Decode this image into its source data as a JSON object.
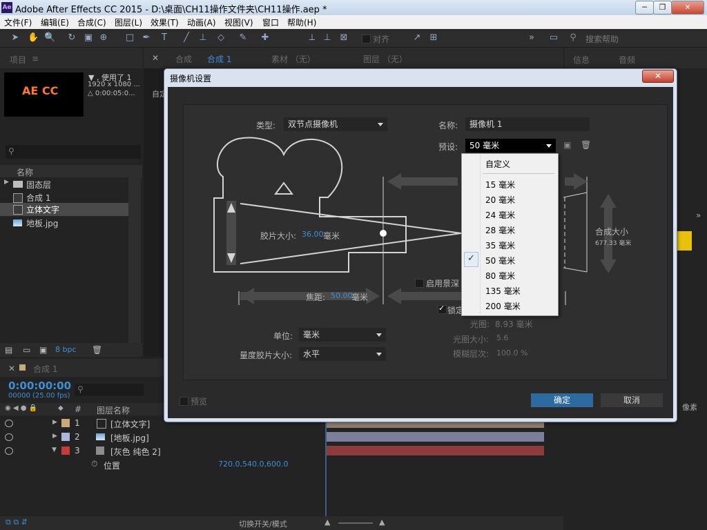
{
  "window": {
    "app_icon": "Ae",
    "title": "Adobe After Effects CC 2015 - D:\\桌面\\CH11操作文件夹\\CH11操作.aep *",
    "minimize": "─",
    "maximize": "❐",
    "close": "✕"
  },
  "menu": [
    "文件(F)",
    "编辑(E)",
    "合成(C)",
    "图层(L)",
    "效果(T)",
    "动画(A)",
    "视图(V)",
    "窗口",
    "帮助(H)"
  ],
  "toolbar": {
    "snap_label": "对齐",
    "search_placeholder": "搜索帮助",
    "more": "»"
  },
  "project": {
    "tab": "项目",
    "menu_glyph": "≡",
    "thumb_text": "AE CC",
    "info_line1": "▼ , 使用了 1",
    "info_line2": "1920 x 1080 ...",
    "info_line3": "△ 0:00:05:0...",
    "col_name": "名称",
    "items": [
      "固态层",
      "合成 1",
      "立体文字",
      "地板.jpg"
    ],
    "bpc": "8 bpc"
  },
  "comp_panel": {
    "tab_label": "合成",
    "tab_name": "合成 1",
    "footage_tab": "素材 （无）",
    "layer_tab": "图层 （无）",
    "partial_label": "自定"
  },
  "right_panel": {
    "info_tab": "信息",
    "audio_tab": "音频",
    "partial_text": "像素"
  },
  "dialog": {
    "title": "摄像机设置",
    "close": "✕",
    "type_label": "类型:",
    "type_value": "双节点摄像机",
    "name_label": "名称:",
    "name_value": "摄像机 1",
    "preset_label": "预设:",
    "preset_value": "50 毫米",
    "film_size_label": "胶片大小:",
    "film_size_value": "36.00",
    "film_size_unit": "毫米",
    "focal_label": "焦距:",
    "focal_value": "50.00",
    "focal_unit": "毫米",
    "comp_size_label": "合成大小",
    "comp_size_value": "677.33 毫米",
    "dof_label": "启用景深",
    "lock_label": "锁定",
    "aperture_label": "光圈:",
    "aperture_value": "8.93 毫米",
    "fstop_label": "光圈大小:",
    "fstop_value": "5.6",
    "blur_label": "模糊层次:",
    "blur_value": "100.0 %",
    "units_label": "单位:",
    "units_value": "毫米",
    "measure_label": "量度胶片大小:",
    "measure_value": "水平",
    "preview_label": "预览",
    "ok": "确定",
    "cancel": "取消",
    "preset_options": [
      "自定义",
      "15 毫米",
      "20 毫米",
      "24 毫米",
      "28 毫米",
      "35 毫米",
      "50 毫米",
      "80 毫米",
      "135 毫米",
      "200 毫米"
    ],
    "selected_option": "50 毫米",
    "check_glyph": "✓"
  },
  "timeline": {
    "tab": "合成 1",
    "timecode": "0:00:00:00",
    "frames": "00000 (25.00 fps)",
    "col_hash": "#",
    "col_layer_name": "图层名称",
    "layers": [
      {
        "num": "1",
        "name": "[立体文字]",
        "color": "#c8a97e"
      },
      {
        "num": "2",
        "name": "[地板.jpg]",
        "color": "#aeb6dd"
      },
      {
        "num": "3",
        "name": "[灰色 纯色 2]",
        "color": "#c43b3b"
      }
    ],
    "prop_name": "位置",
    "prop_value": "720.0,540.0,600.0",
    "toggle_modes": "切换开关/模式"
  },
  "colors": {
    "accent": "#2d6a9f",
    "timecode": "#3d8fd6"
  }
}
